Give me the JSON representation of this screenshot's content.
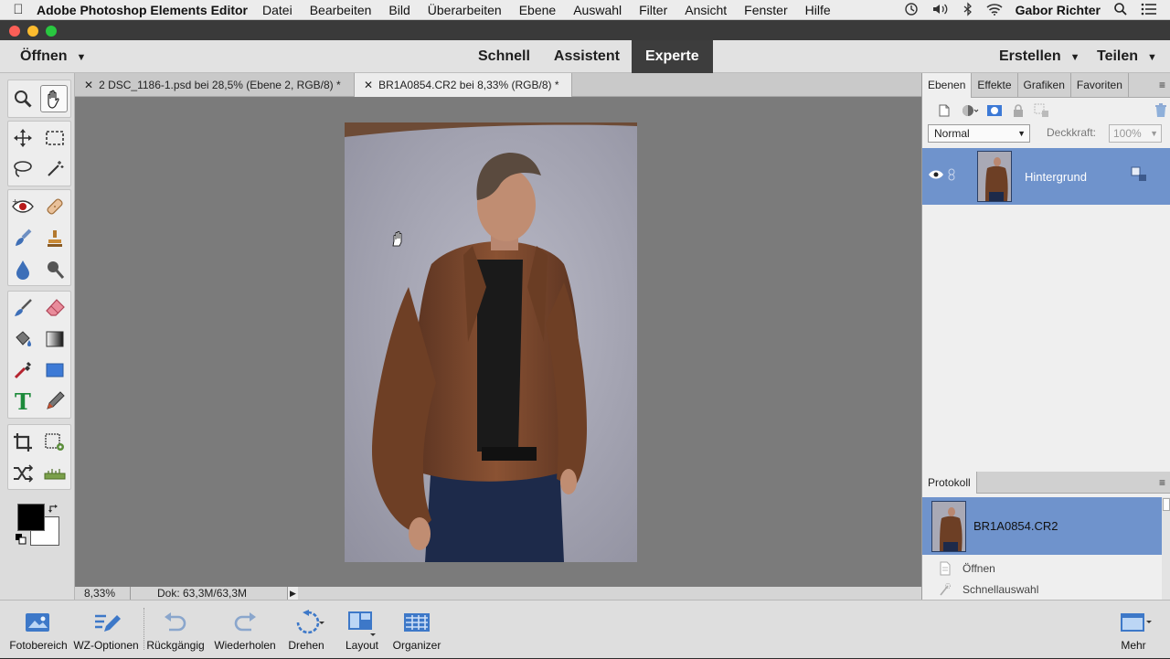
{
  "menubar": {
    "app_name": "Adobe Photoshop Elements Editor",
    "items": [
      "Datei",
      "Bearbeiten",
      "Bild",
      "Überarbeiten",
      "Ebene",
      "Auswahl",
      "Filter",
      "Ansicht",
      "Fenster",
      "Hilfe"
    ],
    "user": "Gabor Richter"
  },
  "topbar": {
    "open_label": "Öffnen",
    "modes": [
      "Schnell",
      "Assistent",
      "Experte"
    ],
    "active_mode": "Experte",
    "create_label": "Erstellen",
    "share_label": "Teilen"
  },
  "doc_tabs": [
    {
      "label": "2 DSC_1186-1.psd bei 28,5% (Ebene 2, RGB/8) *",
      "active": false
    },
    {
      "label": "BR1A0854.CR2 bei 8,33% (RGB/8) *",
      "active": true
    }
  ],
  "status": {
    "zoom": "8,33%",
    "doc_info": "Dok: 63,3M/63,3M"
  },
  "layers_panel": {
    "tabs": [
      "Ebenen",
      "Effekte",
      "Grafiken",
      "Favoriten"
    ],
    "blend_mode": "Normal",
    "opacity_label": "Deckkraft:",
    "opacity_value": "100%",
    "layers": [
      {
        "name": "Hintergrund"
      }
    ]
  },
  "protocol_panel": {
    "title": "Protokoll",
    "snapshot": "BR1A0854.CR2",
    "steps": [
      "Öffnen",
      "Schnellauswahl"
    ]
  },
  "taskbar": {
    "buttons": [
      "Fotobereich",
      "WZ-Optionen",
      "Rückgängig",
      "Wiederholen",
      "Drehen",
      "Layout",
      "Organizer"
    ],
    "more": "Mehr"
  },
  "colors": {
    "accent_active_mode": "#3d3d3d",
    "selection_blue": "#6f93cc",
    "canvas_bg": "#7b7b7b"
  }
}
